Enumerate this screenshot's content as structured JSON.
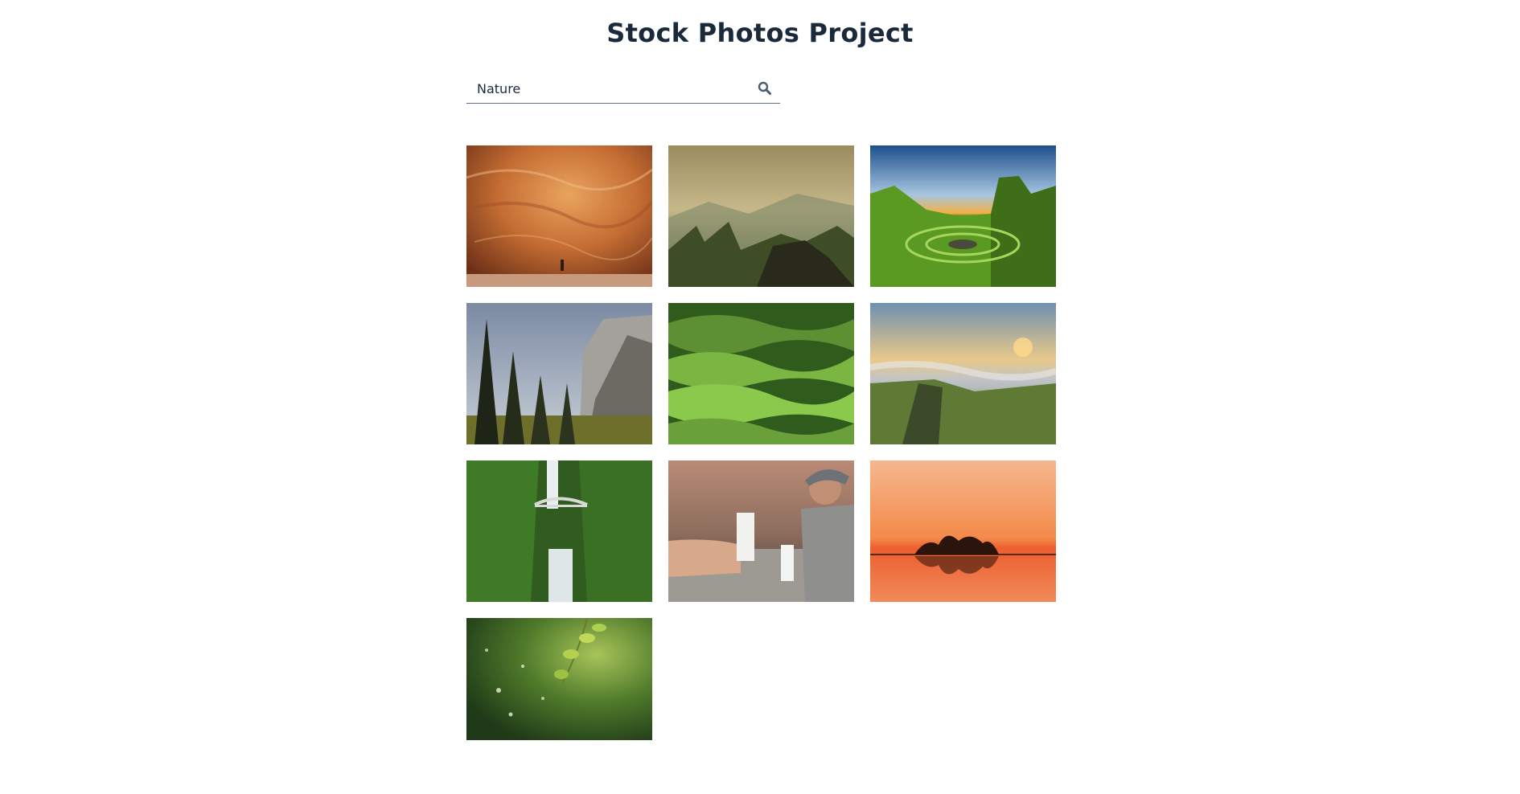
{
  "header": {
    "title": "Stock Photos Project"
  },
  "search": {
    "value": "Nature",
    "icon": "search-icon"
  },
  "colors": {
    "title": "#1b2a3b",
    "search_underline": "#5d6f82",
    "icon": "#4a5d73"
  },
  "gallery": {
    "photos": [
      {
        "subject": "canyon-cave-photo"
      },
      {
        "subject": "misty-mountains-photo"
      },
      {
        "subject": "green-hills-sunset-photo"
      },
      {
        "subject": "yosemite-cliff-photo"
      },
      {
        "subject": "rolling-green-hills-photo"
      },
      {
        "subject": "coastal-cliffs-photo"
      },
      {
        "subject": "waterfall-bridge-photo"
      },
      {
        "subject": "hiker-with-drinks-photo"
      },
      {
        "subject": "orange-lake-sunset-photo"
      },
      {
        "subject": "leaves-bokeh-photo"
      }
    ]
  }
}
